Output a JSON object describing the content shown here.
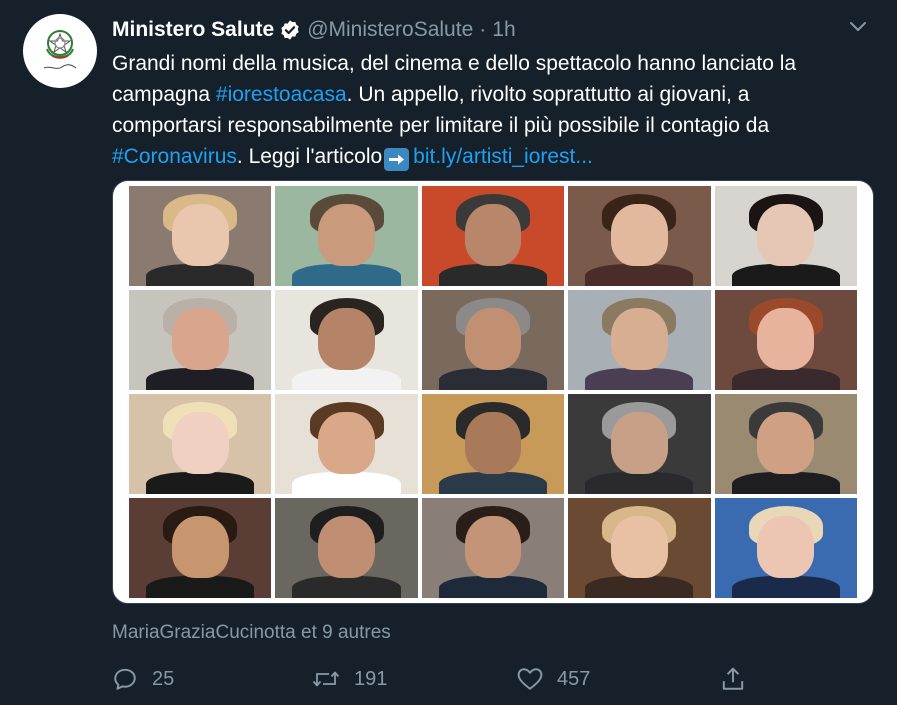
{
  "tweet": {
    "display_name": "Ministero Salute",
    "handle": "@MinisteroSalute",
    "separator": "·",
    "time": "1h",
    "avatar_caption": "Ministero della Salute",
    "text": {
      "line1": "Grandi nomi della musica, del cinema e dello spettacolo hanno lanciato la",
      "line2_prefix": "campagna ",
      "hashtag1": "#iorestoacasa",
      "line2_suffix": ". Un appello, rivolto soprattutto ai giovani, a",
      "line3": "comportarsi responsabilmente per limitare il più possibile il contagio da",
      "hashtag2": "#Coronavirus",
      "line4_middle": ". Leggi l'articolo",
      "url": "bit.ly/artisti_iorest..."
    },
    "likers": "MariaGraziaCucinotta et 9 autres",
    "actions": {
      "reply_count": "25",
      "retweet_count": "191",
      "like_count": "457"
    }
  },
  "colors": {
    "background": "#15202b",
    "accent": "#1da1f2",
    "muted": "#8899a6",
    "border": "#38444d"
  },
  "icons": {
    "verified": "verified-badge-icon",
    "caret": "chevron-down-icon",
    "reply": "reply-icon",
    "retweet": "retweet-icon",
    "like": "heart-icon",
    "share": "share-icon",
    "emoji": "right-arrow-emoji-icon"
  },
  "media": {
    "grid_rows": 4,
    "grid_cols": 5,
    "tiles": [
      {
        "bg": "#8a7a70",
        "face": "#e9c6ae",
        "hair": "#d9b987",
        "body": "#2a2a2a"
      },
      {
        "bg": "#9bb7a0",
        "face": "#c99a7c",
        "hair": "#5a4a3a",
        "body": "#2f6a8a"
      },
      {
        "bg": "#c84a2a",
        "face": "#b8866a",
        "hair": "#3a3a3a",
        "body": "#2a2a2a"
      },
      {
        "bg": "#7a5a4a",
        "face": "#e2b89e",
        "hair": "#3a2418",
        "body": "#4a2c28"
      },
      {
        "bg": "#d8d4d0",
        "face": "#e6c7b6",
        "hair": "#1a1414",
        "body": "#1a1a1a"
      },
      {
        "bg": "#c7c3bd",
        "face": "#d9a58c",
        "hair": "#b9b0a8",
        "body": "#1e1e24"
      },
      {
        "bg": "#e8e4de",
        "face": "#b48368",
        "hair": "#2a2420",
        "body": "#f2f2f2"
      },
      {
        "bg": "#7a6a5e",
        "face": "#c19072",
        "hair": "#8c8a88",
        "body": "#2a2c36"
      },
      {
        "bg": "#a9b0b5",
        "face": "#d7ae92",
        "hair": "#8a7a62",
        "body": "#4a3e52"
      },
      {
        "bg": "#6e4a3e",
        "face": "#e8b39c",
        "hair": "#9a4a2a",
        "body": "#3a2a2e"
      },
      {
        "bg": "#d6c2a8",
        "face": "#f0d0c0",
        "hair": "#f0e0b8",
        "body": "#1a1a1a"
      },
      {
        "bg": "#e6e0d6",
        "face": "#d9a888",
        "hair": "#5a3a22",
        "body": "#ffffff"
      },
      {
        "bg": "#c89a5a",
        "face": "#a87a5a",
        "hair": "#2a2a2a",
        "body": "#2a3a48"
      },
      {
        "bg": "#3a3a3a",
        "face": "#c8a088",
        "hair": "#9a9a9a",
        "body": "#2a2a2e"
      },
      {
        "bg": "#9a8a72",
        "face": "#d0a084",
        "hair": "#3a3a3a",
        "body": "#1e1e22"
      },
      {
        "bg": "#5a3e36",
        "face": "#c8966e",
        "hair": "#2a1a14",
        "body": "#1a1a1a"
      },
      {
        "bg": "#6a6660",
        "face": "#c08e72",
        "hair": "#1e1e1e",
        "body": "#2a2a2a"
      },
      {
        "bg": "#8a7e78",
        "face": "#c49478",
        "hair": "#2a1e18",
        "body": "#1e2a3a"
      },
      {
        "bg": "#6a4a32",
        "face": "#e8c0a4",
        "hair": "#d8b88a",
        "body": "#3a2a22"
      },
      {
        "bg": "#3a6ab0",
        "face": "#ecc6b2",
        "hair": "#e8d8b8",
        "body": "#1a2a4a"
      }
    ]
  }
}
